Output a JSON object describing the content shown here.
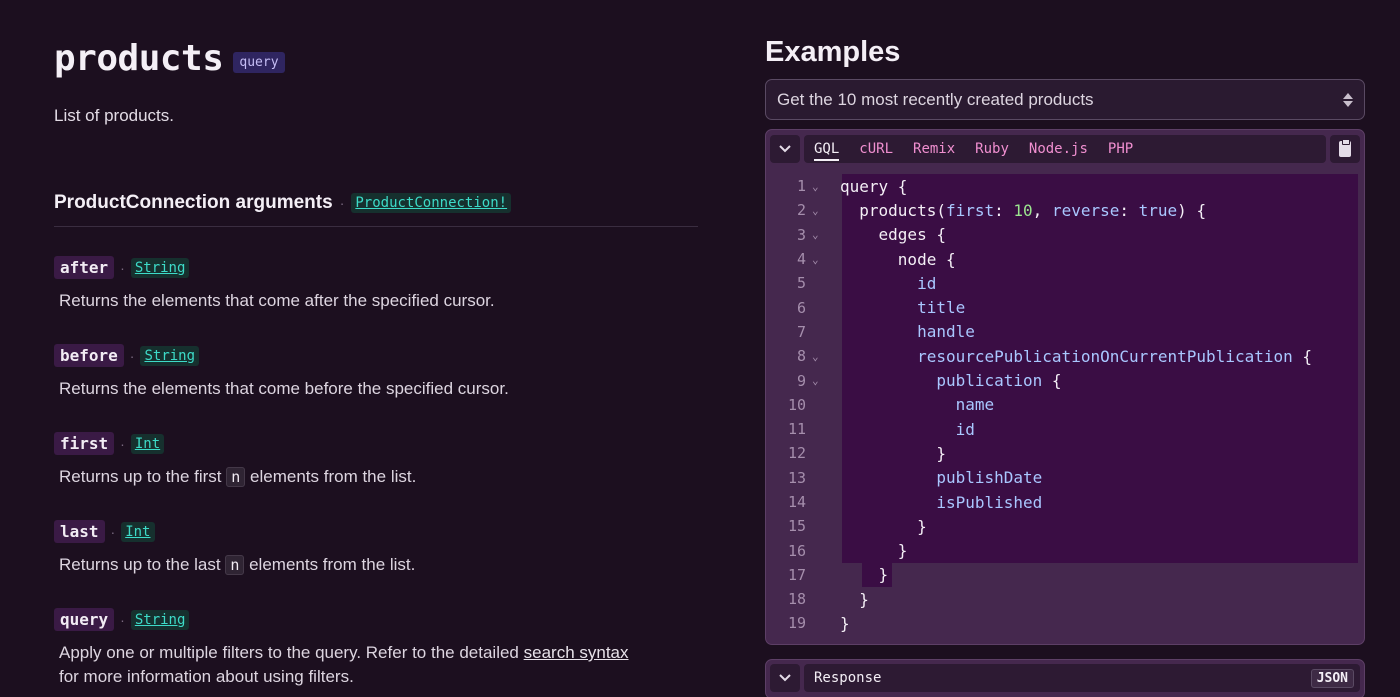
{
  "header": {
    "title": "products",
    "kind": "query",
    "description": "List of products."
  },
  "section": {
    "title": "ProductConnection arguments",
    "type": "ProductConnection!"
  },
  "arguments": [
    {
      "name": "after",
      "type": "String",
      "desc": "Returns the elements that come after the specified cursor."
    },
    {
      "name": "before",
      "type": "String",
      "desc": "Returns the elements that come before the specified cursor."
    },
    {
      "name": "first",
      "type": "Int",
      "desc_pre": "Returns up to the first",
      "code": "n",
      "desc_post": "elements from the list."
    },
    {
      "name": "last",
      "type": "Int",
      "desc_pre": "Returns up to the last",
      "code": "n",
      "desc_post": "elements from the list."
    },
    {
      "name": "query",
      "type": "String",
      "desc_pre": "Apply one or multiple filters to the query. Refer to the detailed",
      "link": "search syntax",
      "desc_post": "for more information about using filters."
    }
  ],
  "examples": {
    "title": "Examples",
    "selected": "Get the 10 most recently created products",
    "tabs": [
      "GQL",
      "cURL",
      "Remix",
      "Ruby",
      "Node.js",
      "PHP"
    ],
    "line_numbers": [
      "1",
      "2",
      "3",
      "4",
      "5",
      "6",
      "7",
      "8",
      "9",
      "10",
      "11",
      "12",
      "13",
      "14",
      "15",
      "16",
      "17",
      "18",
      "19"
    ],
    "code": {
      "l1": "query",
      "l2_field": "products",
      "l2_arg1": "first",
      "l2_val1": "10",
      "l2_arg2": "reverse",
      "l2_val2": "true",
      "l3": "edges",
      "l4": "node",
      "l5": "id",
      "l6": "title",
      "l7": "handle",
      "l8": "resourcePublicationOnCurrentPublication",
      "l9": "publication",
      "l10": "name",
      "l11": "id",
      "l13": "publishDate",
      "l14": "isPublished"
    },
    "response_label": "Response",
    "response_format": "JSON"
  },
  "icons": {
    "collapse": "chevron-down-icon",
    "copy": "clipboard-icon",
    "fold": "fold-chevron-icon"
  },
  "colors": {
    "background": "#1c0f1f",
    "accent_link": "#3ddbc8",
    "tab_color": "#f08fd0",
    "code_panel": "#45284e"
  }
}
